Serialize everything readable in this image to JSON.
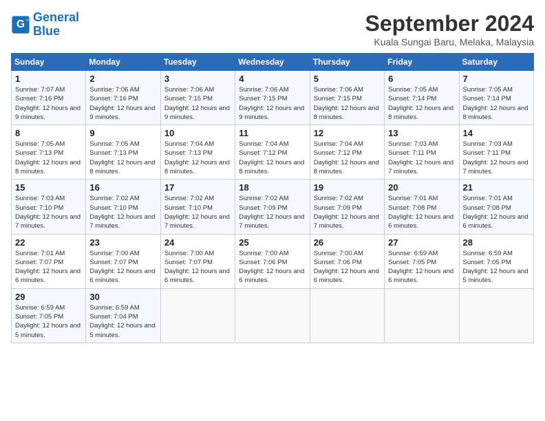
{
  "logo": {
    "line1": "General",
    "line2": "Blue"
  },
  "title": "September 2024",
  "location": "Kuala Sungai Baru, Melaka, Malaysia",
  "weekdays": [
    "Sunday",
    "Monday",
    "Tuesday",
    "Wednesday",
    "Thursday",
    "Friday",
    "Saturday"
  ],
  "weeks": [
    [
      {
        "day": "1",
        "sunrise": "Sunrise: 7:07 AM",
        "sunset": "Sunset: 7:16 PM",
        "daylight": "Daylight: 12 hours and 9 minutes."
      },
      {
        "day": "2",
        "sunrise": "Sunrise: 7:06 AM",
        "sunset": "Sunset: 7:16 PM",
        "daylight": "Daylight: 12 hours and 9 minutes."
      },
      {
        "day": "3",
        "sunrise": "Sunrise: 7:06 AM",
        "sunset": "Sunset: 7:15 PM",
        "daylight": "Daylight: 12 hours and 9 minutes."
      },
      {
        "day": "4",
        "sunrise": "Sunrise: 7:06 AM",
        "sunset": "Sunset: 7:15 PM",
        "daylight": "Daylight: 12 hours and 9 minutes."
      },
      {
        "day": "5",
        "sunrise": "Sunrise: 7:06 AM",
        "sunset": "Sunset: 7:15 PM",
        "daylight": "Daylight: 12 hours and 8 minutes."
      },
      {
        "day": "6",
        "sunrise": "Sunrise: 7:05 AM",
        "sunset": "Sunset: 7:14 PM",
        "daylight": "Daylight: 12 hours and 8 minutes."
      },
      {
        "day": "7",
        "sunrise": "Sunrise: 7:05 AM",
        "sunset": "Sunset: 7:14 PM",
        "daylight": "Daylight: 12 hours and 8 minutes."
      }
    ],
    [
      {
        "day": "8",
        "sunrise": "Sunrise: 7:05 AM",
        "sunset": "Sunset: 7:13 PM",
        "daylight": "Daylight: 12 hours and 8 minutes."
      },
      {
        "day": "9",
        "sunrise": "Sunrise: 7:05 AM",
        "sunset": "Sunset: 7:13 PM",
        "daylight": "Daylight: 12 hours and 8 minutes."
      },
      {
        "day": "10",
        "sunrise": "Sunrise: 7:04 AM",
        "sunset": "Sunset: 7:13 PM",
        "daylight": "Daylight: 12 hours and 8 minutes."
      },
      {
        "day": "11",
        "sunrise": "Sunrise: 7:04 AM",
        "sunset": "Sunset: 7:12 PM",
        "daylight": "Daylight: 12 hours and 8 minutes."
      },
      {
        "day": "12",
        "sunrise": "Sunrise: 7:04 AM",
        "sunset": "Sunset: 7:12 PM",
        "daylight": "Daylight: 12 hours and 8 minutes."
      },
      {
        "day": "13",
        "sunrise": "Sunrise: 7:03 AM",
        "sunset": "Sunset: 7:11 PM",
        "daylight": "Daylight: 12 hours and 7 minutes."
      },
      {
        "day": "14",
        "sunrise": "Sunrise: 7:03 AM",
        "sunset": "Sunset: 7:11 PM",
        "daylight": "Daylight: 12 hours and 7 minutes."
      }
    ],
    [
      {
        "day": "15",
        "sunrise": "Sunrise: 7:03 AM",
        "sunset": "Sunset: 7:10 PM",
        "daylight": "Daylight: 12 hours and 7 minutes."
      },
      {
        "day": "16",
        "sunrise": "Sunrise: 7:02 AM",
        "sunset": "Sunset: 7:10 PM",
        "daylight": "Daylight: 12 hours and 7 minutes."
      },
      {
        "day": "17",
        "sunrise": "Sunrise: 7:02 AM",
        "sunset": "Sunset: 7:10 PM",
        "daylight": "Daylight: 12 hours and 7 minutes."
      },
      {
        "day": "18",
        "sunrise": "Sunrise: 7:02 AM",
        "sunset": "Sunset: 7:09 PM",
        "daylight": "Daylight: 12 hours and 7 minutes."
      },
      {
        "day": "19",
        "sunrise": "Sunrise: 7:02 AM",
        "sunset": "Sunset: 7:09 PM",
        "daylight": "Daylight: 12 hours and 7 minutes."
      },
      {
        "day": "20",
        "sunrise": "Sunrise: 7:01 AM",
        "sunset": "Sunset: 7:08 PM",
        "daylight": "Daylight: 12 hours and 6 minutes."
      },
      {
        "day": "21",
        "sunrise": "Sunrise: 7:01 AM",
        "sunset": "Sunset: 7:08 PM",
        "daylight": "Daylight: 12 hours and 6 minutes."
      }
    ],
    [
      {
        "day": "22",
        "sunrise": "Sunrise: 7:01 AM",
        "sunset": "Sunset: 7:07 PM",
        "daylight": "Daylight: 12 hours and 6 minutes."
      },
      {
        "day": "23",
        "sunrise": "Sunrise: 7:00 AM",
        "sunset": "Sunset: 7:07 PM",
        "daylight": "Daylight: 12 hours and 6 minutes."
      },
      {
        "day": "24",
        "sunrise": "Sunrise: 7:00 AM",
        "sunset": "Sunset: 7:07 PM",
        "daylight": "Daylight: 12 hours and 6 minutes."
      },
      {
        "day": "25",
        "sunrise": "Sunrise: 7:00 AM",
        "sunset": "Sunset: 7:06 PM",
        "daylight": "Daylight: 12 hours and 6 minutes."
      },
      {
        "day": "26",
        "sunrise": "Sunrise: 7:00 AM",
        "sunset": "Sunset: 7:06 PM",
        "daylight": "Daylight: 12 hours and 6 minutes."
      },
      {
        "day": "27",
        "sunrise": "Sunrise: 6:59 AM",
        "sunset": "Sunset: 7:05 PM",
        "daylight": "Daylight: 12 hours and 6 minutes."
      },
      {
        "day": "28",
        "sunrise": "Sunrise: 6:59 AM",
        "sunset": "Sunset: 7:05 PM",
        "daylight": "Daylight: 12 hours and 5 minutes."
      }
    ],
    [
      {
        "day": "29",
        "sunrise": "Sunrise: 6:59 AM",
        "sunset": "Sunset: 7:05 PM",
        "daylight": "Daylight: 12 hours and 5 minutes."
      },
      {
        "day": "30",
        "sunrise": "Sunrise: 6:59 AM",
        "sunset": "Sunset: 7:04 PM",
        "daylight": "Daylight: 12 hours and 5 minutes."
      },
      null,
      null,
      null,
      null,
      null
    ]
  ]
}
